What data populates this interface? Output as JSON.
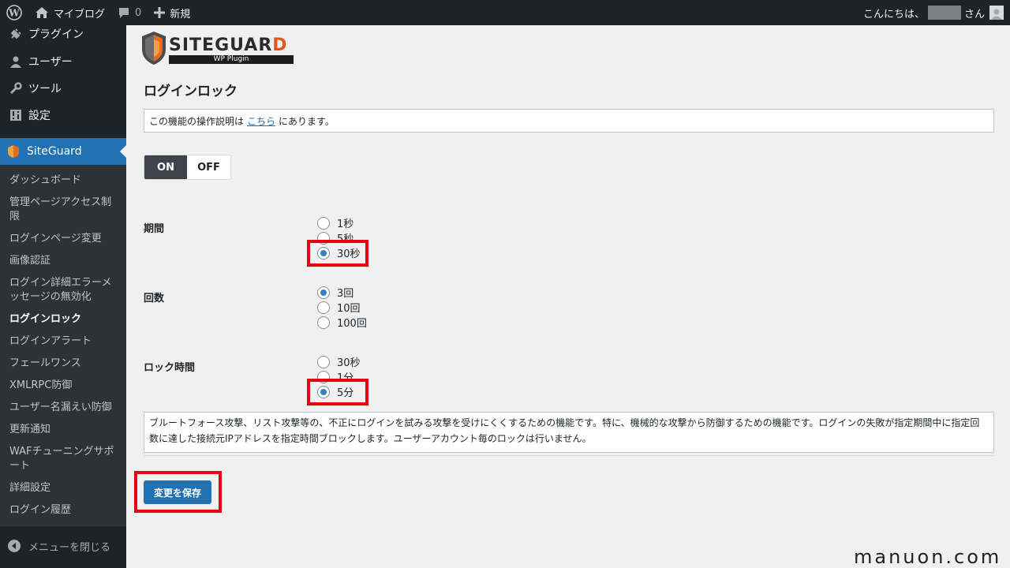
{
  "adminbar": {
    "site_name": "マイブログ",
    "comments_count": "0",
    "new_label": "新規",
    "greeting": "こんにちは、",
    "greeting_suffix": "さん"
  },
  "sidebar": {
    "top_items": [
      {
        "label": "プラグイン",
        "icon": "plugin-icon"
      },
      {
        "label": "ユーザー",
        "icon": "user-icon"
      },
      {
        "label": "ツール",
        "icon": "wrench-icon"
      },
      {
        "label": "設定",
        "icon": "settings-icon"
      }
    ],
    "current": {
      "label": "SiteGuard",
      "icon": "siteguard-shield-icon"
    },
    "submenu": [
      "ダッシュボード",
      "管理ページアクセス制限",
      "ログインページ変更",
      "画像認証",
      "ログイン詳細エラーメッセージの無効化",
      "ログインロック",
      "ログインアラート",
      "フェールワンス",
      "XMLRPC防御",
      "ユーザー名漏えい防御",
      "更新通知",
      "WAFチューニングサポート",
      "詳細設定",
      "ログイン履歴"
    ],
    "current_sub": "ログインロック",
    "collapse_label": "メニューを閉じる"
  },
  "logo": {
    "main_before": "SITEGUAR",
    "main_accent": "D",
    "sub": "WP Plugin"
  },
  "page": {
    "title": "ログインロック",
    "notice_before": "この機能の操作説明は",
    "notice_link": "こちら",
    "notice_after": "にあります。",
    "toggle_on": "ON",
    "toggle_off": "OFF",
    "toggle_state": "ON",
    "fields": {
      "period": {
        "label": "期間",
        "options": [
          "1秒",
          "5秒",
          "30秒"
        ],
        "selected": "30秒"
      },
      "count": {
        "label": "回数",
        "options": [
          "3回",
          "10回",
          "100回"
        ],
        "selected": "3回"
      },
      "lock_time": {
        "label": "ロック時間",
        "options": [
          "30秒",
          "1分",
          "5分"
        ],
        "selected": "5分"
      }
    },
    "description": "ブルートフォース攻撃、リスト攻撃等の、不正にログインを試みる攻撃を受けにくくするための機能です。特に、機械的な攻撃から防御するための機能です。ログインの失敗が指定期間中に指定回数に達した接続元IPアドレスを指定時間ブロックします。ユーザーアカウント毎のロックは行いません。",
    "save_label": "変更を保存"
  },
  "watermark": "manuon.com",
  "colors": {
    "highlight": "#e60012",
    "primary": "#2271b1",
    "adminbar": "#1d2327"
  }
}
